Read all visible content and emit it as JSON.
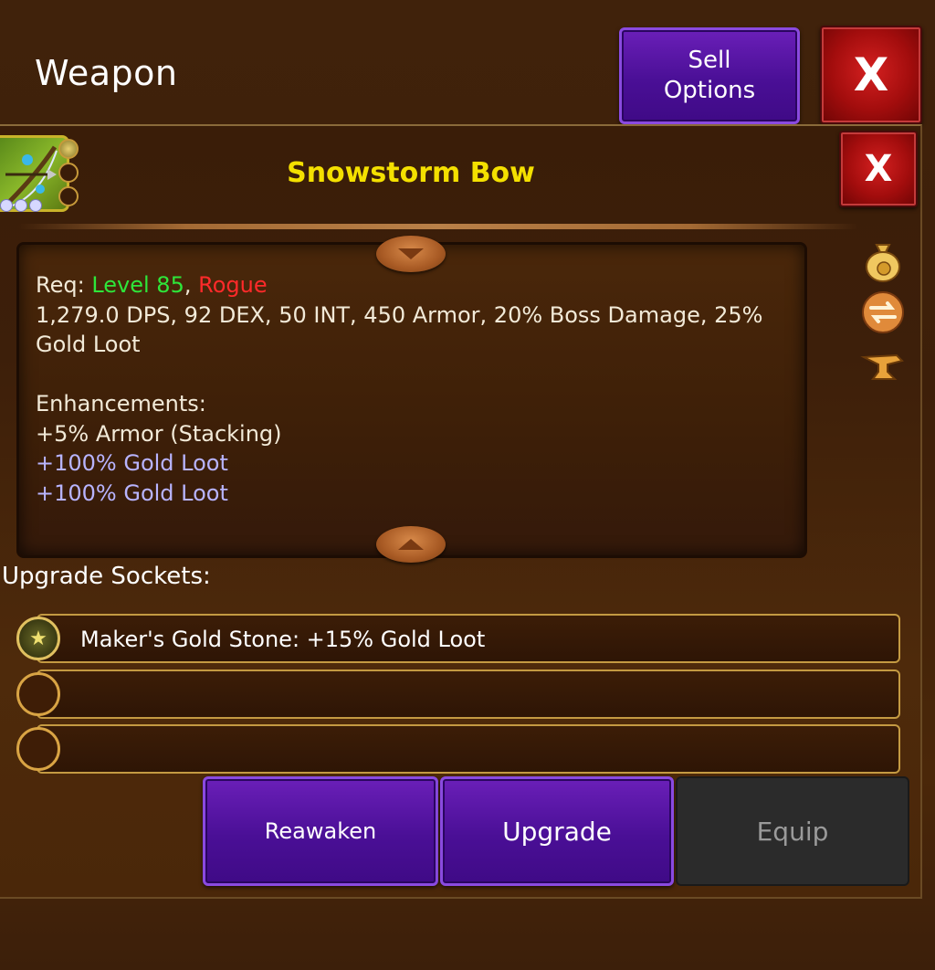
{
  "header": {
    "title": "Weapon",
    "sell_line1": "Sell",
    "sell_line2": "Options",
    "close_label": "X"
  },
  "item": {
    "name": "Snowstorm Bow",
    "close_label": "X",
    "req_label": "Req: ",
    "req_level": "Level 85",
    "req_sep": ", ",
    "req_class": "Rogue",
    "stats_line1": "1,279.0 DPS, 92 DEX, 50 INT, 450 Armor, 20% Boss Damage, 25%",
    "stats_line2": "Gold Loot",
    "enh_header": "Enhancements:",
    "enh_1": "+5% Armor (Stacking)",
    "enh_2": "+100% Gold Loot",
    "enh_3": "+100% Gold Loot"
  },
  "side_icons": [
    "gold-bag-icon",
    "swap-icon",
    "anvil-icon"
  ],
  "sockets": {
    "label": "Upgrade Sockets:",
    "slots": [
      {
        "text": "Maker's Gold Stone: +15% Gold Loot",
        "filled": true
      },
      {
        "text": "",
        "filled": false
      },
      {
        "text": "",
        "filled": false
      }
    ]
  },
  "actions": {
    "reawaken": "Reawaken",
    "upgrade": "Upgrade",
    "equip": "Equip"
  },
  "colors": {
    "accent_purple": "#4a0f96",
    "close_red": "#a30d0d",
    "item_name": "#f4e000",
    "req_level": "#2ee63a",
    "req_class": "#ff2a2a",
    "enhancement_bonus": "#b8b4ff"
  }
}
